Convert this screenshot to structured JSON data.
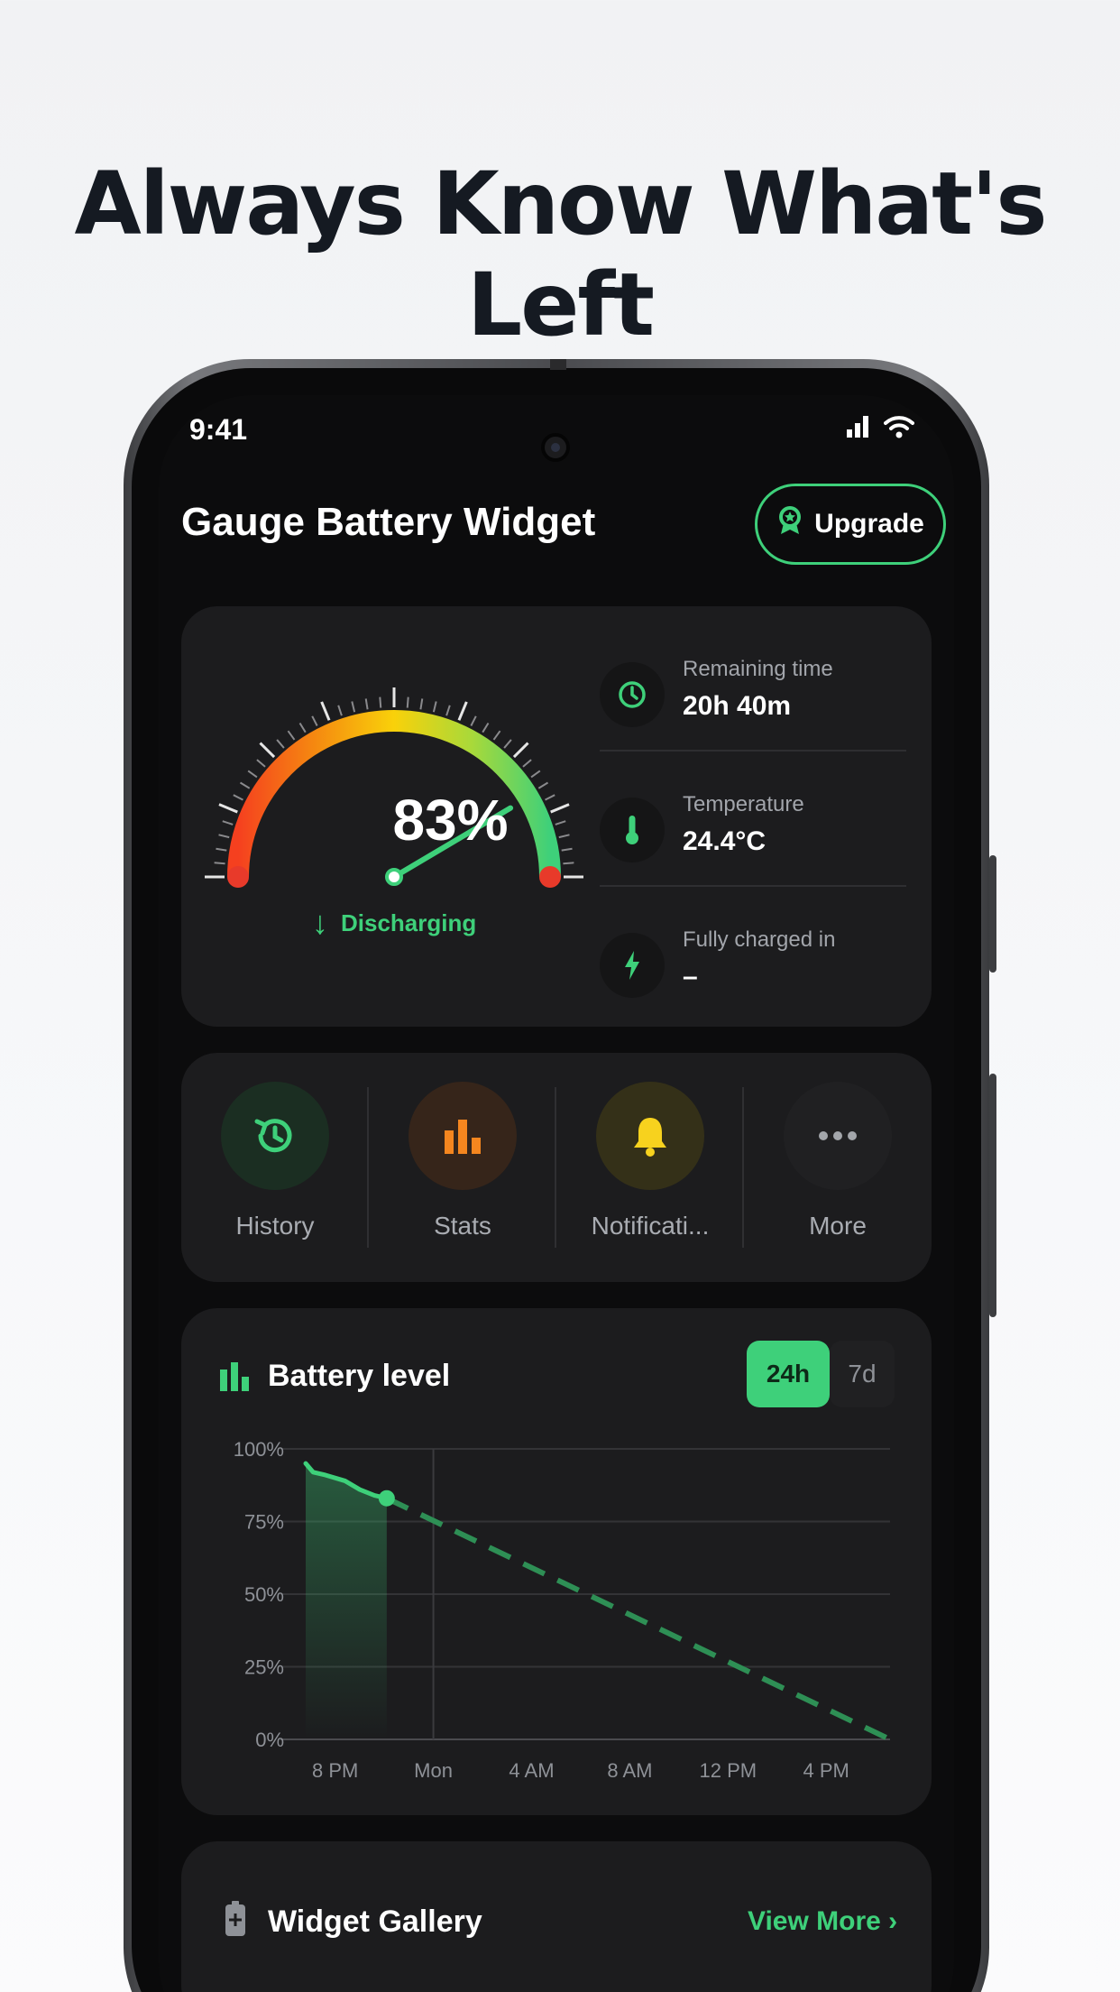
{
  "headline": "Always Know What's Left",
  "status_bar": {
    "time": "9:41"
  },
  "app": {
    "title": "Gauge Battery Widget",
    "upgrade_label": "Upgrade"
  },
  "gauge": {
    "percent_label": "83%",
    "level": 0.83,
    "status": "Discharging",
    "status_arrow": "↓"
  },
  "stats": [
    {
      "icon": "clock-icon",
      "label": "Remaining time",
      "value": "20h 40m"
    },
    {
      "icon": "thermometer-icon",
      "label": "Temperature",
      "value": "24.4°C"
    },
    {
      "icon": "lightning-icon",
      "label": "Fully charged in",
      "value": "–"
    }
  ],
  "actions": [
    {
      "icon": "history-icon",
      "label": "History",
      "color": "#3ed07a",
      "bg": "#1b2e22"
    },
    {
      "icon": "bar-chart-icon",
      "label": "Stats",
      "color": "#f5861f",
      "bg": "#36251a"
    },
    {
      "icon": "bell-icon",
      "label": "Notificati...",
      "color": "#f7d21e",
      "bg": "#343018"
    },
    {
      "icon": "more-dots-icon",
      "label": "More",
      "color": "#a3a6ab",
      "bg": "#202022"
    }
  ],
  "battery_chart": {
    "title": "Battery level",
    "ranges": [
      "24h",
      "7d"
    ],
    "selected_range": "24h"
  },
  "chart_data": {
    "type": "line",
    "title": "Battery level",
    "xlabel": "",
    "ylabel": "",
    "x_ticks": [
      "8 PM",
      "Mon",
      "4 AM",
      "8 AM",
      "12 PM",
      "4 PM"
    ],
    "y_ticks": [
      "0%",
      "25%",
      "50%",
      "75%",
      "100%"
    ],
    "ylim": [
      0,
      100
    ],
    "x_range_hours": [
      -1.2,
      22.6
    ],
    "series": [
      {
        "style": "solid",
        "x": [
          -1.2,
          -0.9,
          -0.4,
          0.4,
          1.0,
          1.6,
          2.1
        ],
        "y": [
          95,
          92,
          91,
          89,
          86,
          84,
          83
        ]
      },
      {
        "style": "dashed",
        "x": [
          2.1,
          22.6
        ],
        "y": [
          83,
          0
        ]
      }
    ],
    "marker": {
      "x": 2.1,
      "y": 83
    },
    "vertical_line_at": 4,
    "colors": {
      "line": "#3ed07a",
      "dashed": "#2e8f55",
      "grid": "#333336"
    }
  },
  "gallery": {
    "title": "Widget Gallery",
    "view_more": "View More ›"
  },
  "colors": {
    "accent": "#3ed07a",
    "card": "#1c1c1e",
    "screen": "#0c0c0d"
  }
}
